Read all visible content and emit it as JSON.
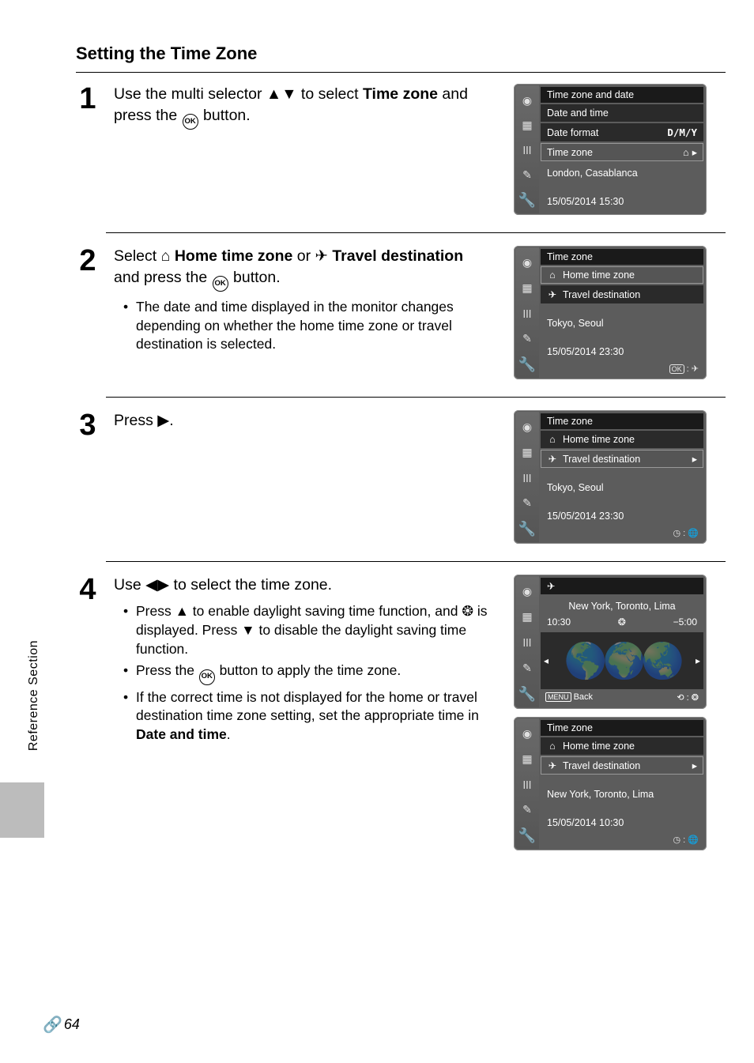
{
  "page": {
    "heading": "Setting the Time Zone",
    "sidebar_label": "Reference Section",
    "page_number": "64"
  },
  "step1": {
    "num": "1",
    "text_a": "Use the multi selector ",
    "text_b": " to select ",
    "text_c": " and press the ",
    "text_d": " button.",
    "bold1": "Time zone",
    "screen": {
      "title": "Time zone and date",
      "r1": "Date and time",
      "r2_l": "Date format",
      "r2_r": "D/M/Y",
      "r3": "Time zone",
      "loc": "London, Casablanca",
      "dt": "15/05/2014  15:30"
    }
  },
  "step2": {
    "num": "2",
    "text_a": "Select ",
    "bold1": "Home time zone",
    "text_b": " or ",
    "bold2": "Travel destination",
    "text_c": " and press the ",
    "text_d": " button.",
    "bullet": "The date and time displayed in the monitor changes depending on whether the home time zone or travel destination is selected.",
    "screen": {
      "title": "Time zone",
      "opt1": "Home time zone",
      "opt2": "Travel destination",
      "loc": "Tokyo, Seoul",
      "dt": "15/05/2014  23:30"
    }
  },
  "step3": {
    "num": "3",
    "text": "Press ",
    "screen": {
      "title": "Time zone",
      "opt1": "Home time zone",
      "opt2": "Travel destination",
      "loc": "Tokyo, Seoul",
      "dt": "15/05/2014  23:30"
    }
  },
  "step4": {
    "num": "4",
    "text_a": "Use ",
    "text_b": " to select the time zone.",
    "b1a": "Press ",
    "b1b": " to enable daylight saving time function, and ",
    "b1c": " is displayed. Press ",
    "b1d": " to disable the daylight saving time function.",
    "b2a": "Press the ",
    "b2b": " button to apply the time zone.",
    "b3a": "If the correct time is not displayed for the home or travel destination time zone setting, set the appropriate time in ",
    "b3bold": "Date and time",
    "b3b": ".",
    "screenA": {
      "loc": "New York, Toronto, Lima",
      "time": "10:30",
      "offset": "−5:00",
      "back": "Back"
    },
    "screenB": {
      "title": "Time zone",
      "opt1": "Home time zone",
      "opt2": "Travel destination",
      "loc": "New York, Toronto, Lima",
      "dt": "15/05/2014  10:30"
    }
  }
}
